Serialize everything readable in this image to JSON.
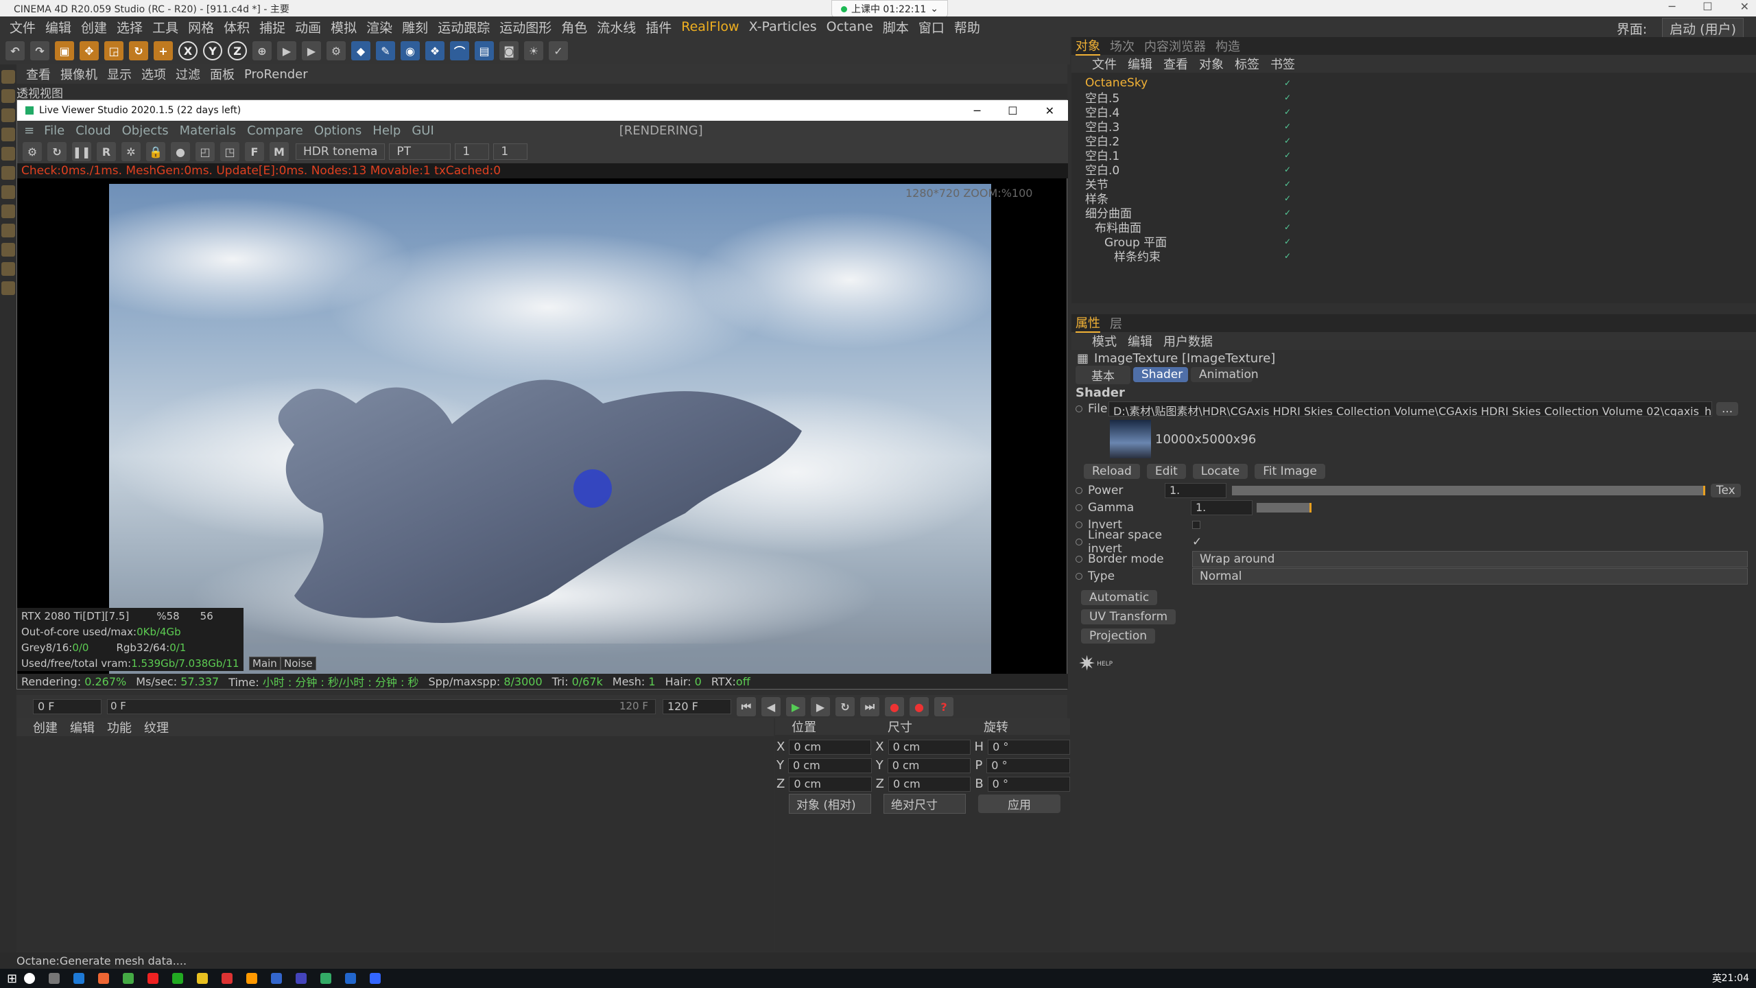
{
  "window": {
    "title": "CINEMA 4D R20.059 Studio (RC - R20) - [911.c4d *] - 主要"
  },
  "recording": {
    "label": "上课中 01:22:11"
  },
  "menubar": {
    "items": [
      "文件",
      "编辑",
      "创建",
      "选择",
      "工具",
      "网格",
      "体积",
      "捕捉",
      "动画",
      "模拟",
      "渲染",
      "雕刻",
      "运动跟踪",
      "运动图形",
      "角色",
      "流水线",
      "插件",
      "RealFlow",
      "X-Particles",
      "Octane",
      "脚本",
      "窗口",
      "帮助"
    ],
    "layout_label": "界面:",
    "layout_value": "启动 (用户)"
  },
  "toolbar": {
    "axis_labels": [
      "X",
      "Y",
      "Z"
    ]
  },
  "viewport": {
    "menu": [
      "查看",
      "摄像机",
      "显示",
      "选项",
      "过滤",
      "面板",
      "ProRender"
    ],
    "title": "透视视图"
  },
  "liveviewer": {
    "title": "Live Viewer Studio 2020.1.5 (22 days left)",
    "menu": [
      "File",
      "Cloud",
      "Objects",
      "Materials",
      "Compare",
      "Options",
      "Help",
      "GUI"
    ],
    "status": "[RENDERING]",
    "tonemap": "HDR tonema",
    "kernel": "PT",
    "field1": "1",
    "field2": "1",
    "info": "Check:0ms./1ms. MeshGen:0ms. Update[E]:0ms. Nodes:13 Movable:1 txCached:0",
    "zoom": "1280*720 ZOOM:%100",
    "gpu": "RTX 2080 Ti[DT][7.5]",
    "gpu_pct": "%58",
    "gpu_temp": "56",
    "ooc_label": "Out-of-core used/max:",
    "ooc_value": "0Kb/4Gb",
    "grey_label": "Grey8/16:",
    "grey_value": "0/0",
    "rgb_label": "Rgb32/64:",
    "rgb_value": "0/1",
    "vram_label": "Used/free/total vram:",
    "vram_value": "1.539Gb/7.038Gb/11",
    "tab_main": "Main",
    "tab_noise": "Noise",
    "rendering_label": "Rendering:",
    "rendering_value": "0.267%",
    "ms_label": "Ms/sec:",
    "ms_value": "57.337",
    "time_label": "Time:",
    "time_value": "小时 : 分钟 : 秒/小时 : 分钟 : 秒",
    "spp_label": "Spp/maxspp:",
    "spp_value": "8/3000",
    "tri_label": "Tri:",
    "tri_value": "0/67k",
    "mesh_label": "Mesh:",
    "mesh_value": "1",
    "hair_label": "Hair:",
    "hair_value": "0",
    "rtx_label": "RTX:",
    "rtx_value": "off"
  },
  "timeline": {
    "start": "0 F",
    "cursor": "0 F",
    "end_mark": "120 F",
    "end": "120 F"
  },
  "material_panel": {
    "menu": [
      "创建",
      "编辑",
      "功能",
      "纹理"
    ]
  },
  "coord_panel": {
    "headers": [
      "位置",
      "尺寸",
      "旋转"
    ],
    "rows": [
      {
        "a": "X",
        "p": "0 cm",
        "b": "X",
        "s": "0 cm",
        "c": "H",
        "r": "0 °"
      },
      {
        "a": "Y",
        "p": "0 cm",
        "b": "Y",
        "s": "0 cm",
        "c": "P",
        "r": "0 °"
      },
      {
        "a": "Z",
        "p": "0 cm",
        "b": "Z",
        "s": "0 cm",
        "c": "B",
        "r": "0 °"
      }
    ],
    "mode": "对象 (相对)",
    "size_mode": "绝对尺寸",
    "apply": "应用"
  },
  "object_manager": {
    "tabs": [
      "对象",
      "场次",
      "内容浏览器",
      "构造"
    ],
    "menu": [
      "文件",
      "编辑",
      "查看",
      "对象",
      "标签",
      "书签"
    ],
    "items": [
      {
        "name": "OctaneSky",
        "indent": 0,
        "hl": true
      },
      {
        "name": "空白.5",
        "indent": 0
      },
      {
        "name": "空白.4",
        "indent": 0
      },
      {
        "name": "空白.3",
        "indent": 0
      },
      {
        "name": "空白.2",
        "indent": 0
      },
      {
        "name": "空白.1",
        "indent": 0
      },
      {
        "name": "空白.0",
        "indent": 0
      },
      {
        "name": "关节",
        "indent": 0
      },
      {
        "name": "样条",
        "indent": 0
      },
      {
        "name": "细分曲面",
        "indent": 0
      },
      {
        "name": "布料曲面",
        "indent": 1
      },
      {
        "name": "Group 平面",
        "indent": 2
      },
      {
        "name": "样条约束",
        "indent": 3
      }
    ]
  },
  "attributes": {
    "tabs": [
      "属性",
      "层"
    ],
    "menu": [
      "模式",
      "编辑",
      "用户数据"
    ],
    "object": "ImageTexture [ImageTexture]",
    "subtabs": [
      "基本",
      "Shader",
      "Animation"
    ],
    "section": "Shader",
    "file_label": "File",
    "file_path": "D:\\素材\\贴图素材\\HDR\\CGAxis HDRI Skies Collection Volume\\CGAxis HDRI Skies Collection Volume 02\\cgaxis_hdri",
    "file_btn": "...",
    "thumb_info": "10000x5000x96",
    "buttons": [
      "Reload",
      "Edit",
      "Locate",
      "Fit Image"
    ],
    "power_label": "Power",
    "power_value": "1.",
    "power_btn": "Tex",
    "gamma_label": "Gamma",
    "gamma_value": "1.",
    "invert_label": "Invert",
    "linear_label": "Linear space invert",
    "border_label": "Border mode",
    "border_value": "Wrap around",
    "type_label": "Type",
    "type_value": "Normal",
    "groups": [
      "Automatic",
      "UV Transform",
      "Projection"
    ],
    "help": "HELP"
  },
  "statusbar": {
    "text": "Octane:Generate mesh data...."
  },
  "taskbar": {
    "time": "21:04",
    "lang": "英"
  },
  "colors": {
    "accent": "#f2b236",
    "status_red": "#e04020",
    "value_green": "#5ccc52"
  }
}
